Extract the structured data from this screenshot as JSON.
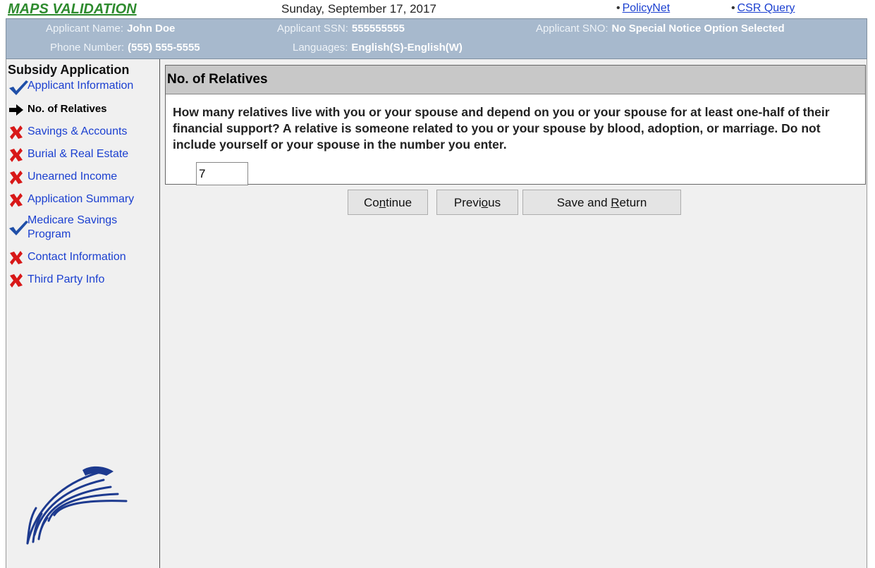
{
  "app_title": "MAPS VALIDATION",
  "date": "Sunday, September 17, 2017",
  "top_links": [
    {
      "bullet": "•",
      "label": "PolicyNet"
    },
    {
      "bullet": "•",
      "label": "CSR Query"
    }
  ],
  "applicant": {
    "name_label": "Applicant Name:",
    "name": "John Doe",
    "ssn_label": "Applicant SSN:",
    "ssn": "555555555",
    "sno_label": "Applicant SNO:",
    "sno": "No Special Notice Option Selected",
    "phone_label": "Phone Number:",
    "phone": "(555) 555-5555",
    "languages_label": "Languages:",
    "languages": "English(S)-English(W)"
  },
  "sidebar": {
    "title": "Subsidy Application",
    "items": [
      {
        "label": "Applicant Information",
        "status": "check-icon"
      },
      {
        "label": "No. of Relatives",
        "status": "arrow-right-icon"
      },
      {
        "label": "Savings & Accounts",
        "status": "x-icon"
      },
      {
        "label": "Burial & Real Estate",
        "status": "x-icon"
      },
      {
        "label": "Unearned Income",
        "status": "x-icon"
      },
      {
        "label": "Application Summary",
        "status": "x-icon"
      },
      {
        "label": "Medicare Savings",
        "label2": "Program",
        "status": "check-icon"
      },
      {
        "label": "Contact Information",
        "status": "x-icon"
      },
      {
        "label": "Third Party Info",
        "status": "x-icon"
      }
    ]
  },
  "panel": {
    "header": "No. of Relatives",
    "question": "How many relatives live with you or your spouse and depend on you or your spouse for at least one-half of their financial support? A relative is someone related to you or your spouse by blood, adoption, or marriage. Do not include yourself or your spouse in the number you enter.",
    "input_value": "7"
  },
  "buttons": {
    "continue": {
      "pre": "Co",
      "key": "n",
      "post": "tinue"
    },
    "previous": {
      "pre": "Previ",
      "key": "o",
      "post": "us"
    },
    "save": {
      "pre": "Save and ",
      "key": "R",
      "post": "eturn"
    }
  },
  "colors": {
    "title_green": "#2e8b2e",
    "info_band": "#a7b9cd",
    "link_blue": "#1a3fd0",
    "check_blue": "#1f4fa8",
    "x_red": "#d81818"
  }
}
